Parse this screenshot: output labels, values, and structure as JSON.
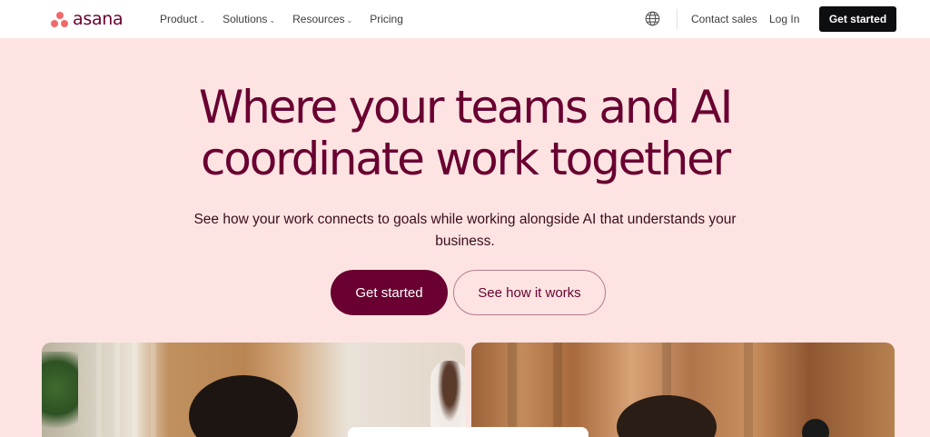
{
  "header": {
    "logo_text": "asana",
    "nav": [
      {
        "label": "Product",
        "has_dropdown": true
      },
      {
        "label": "Solutions",
        "has_dropdown": true
      },
      {
        "label": "Resources",
        "has_dropdown": true
      },
      {
        "label": "Pricing",
        "has_dropdown": false
      }
    ],
    "globe_icon": "globe-icon",
    "contact_sales": "Contact sales",
    "log_in": "Log In",
    "cta": "Get started"
  },
  "hero": {
    "title_line1": "Where your teams and AI",
    "title_line2": "coordinate work together",
    "subtitle": "See how your work connects to goals while working alongside AI that understands your business.",
    "primary_button": "Get started",
    "secondary_button": "See how it works"
  },
  "colors": {
    "brand": "#690031",
    "hero_bg": "#fde4e2",
    "logo_coral": "#f06a6a",
    "header_cta_bg": "#0d0e10"
  }
}
